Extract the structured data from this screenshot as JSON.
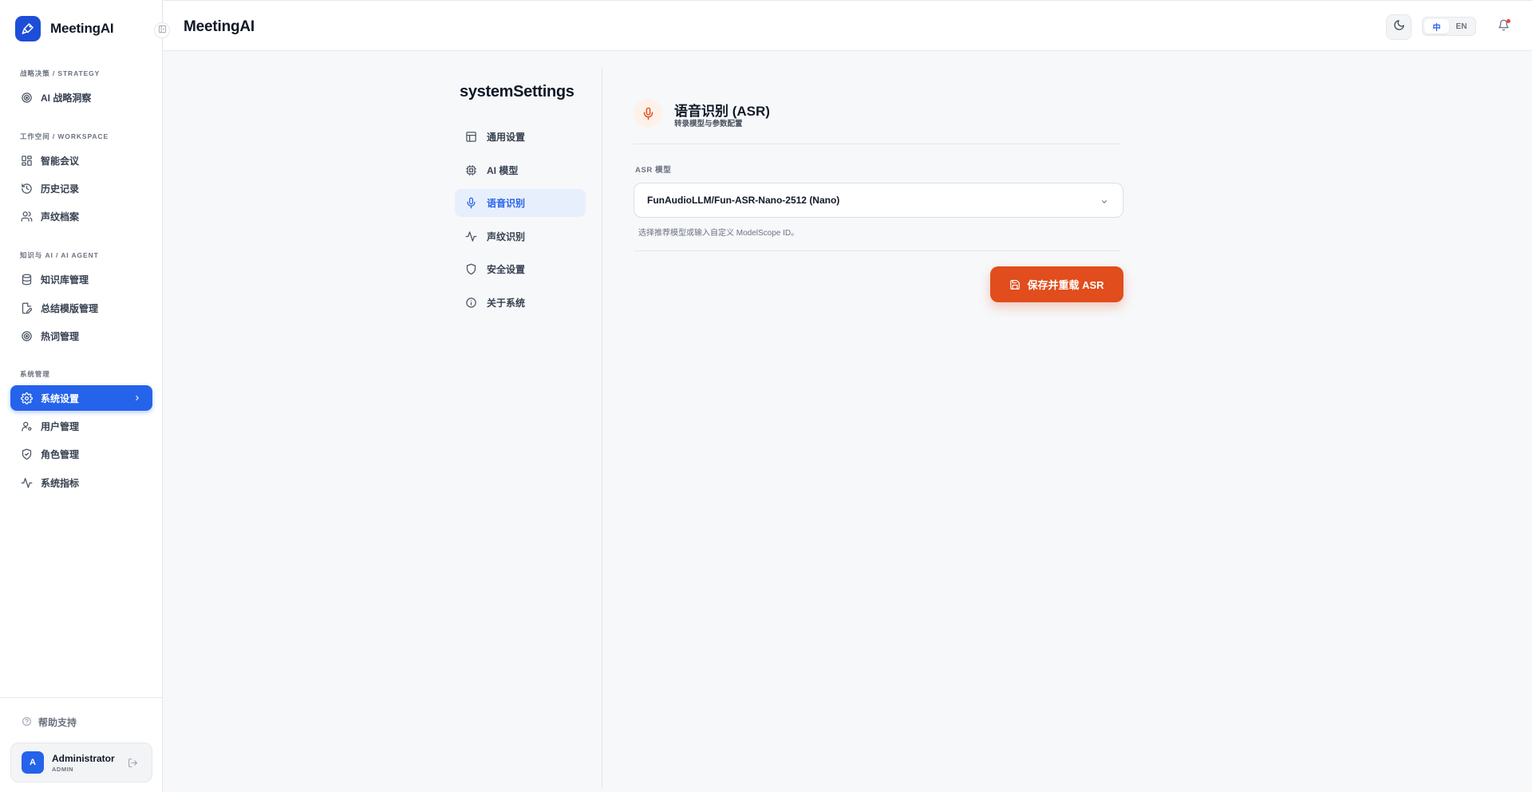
{
  "app": {
    "brand": "MeetingAI",
    "header_title": "MeetingAI"
  },
  "sidebar": {
    "groups": [
      {
        "title": "战略决策 / STRATEGY",
        "items": [
          {
            "label": "AI 战略洞察",
            "icon": "target-icon"
          }
        ]
      },
      {
        "title": "工作空间 / WORKSPACE",
        "items": [
          {
            "label": "智能会议",
            "icon": "grid-icon"
          },
          {
            "label": "历史记录",
            "icon": "history-icon"
          },
          {
            "label": "声纹档案",
            "icon": "users-icon"
          }
        ]
      },
      {
        "title": "知识与 AI / AI AGENT",
        "items": [
          {
            "label": "知识库管理",
            "icon": "database-icon"
          },
          {
            "label": "总结模版管理",
            "icon": "file-edit-icon"
          },
          {
            "label": "热词管理",
            "icon": "target-icon"
          }
        ]
      },
      {
        "title": "系统管理",
        "items": [
          {
            "label": "系统设置",
            "icon": "gear-icon",
            "active": true
          },
          {
            "label": "用户管理",
            "icon": "user-gear-icon"
          },
          {
            "label": "角色管理",
            "icon": "shield-check-icon"
          },
          {
            "label": "系统指标",
            "icon": "activity-icon"
          }
        ]
      }
    ],
    "help": "帮助支持",
    "user": {
      "initial": "A",
      "name": "Administrator",
      "role": "ADMIN"
    }
  },
  "topbar": {
    "lang": {
      "zh": "中",
      "en": "EN",
      "selected": "中"
    },
    "has_notification": true
  },
  "settings": {
    "title": "systemSettings",
    "menu": [
      {
        "label": "通用设置",
        "icon": "layout-icon"
      },
      {
        "label": "AI 模型",
        "icon": "cpu-icon"
      },
      {
        "label": "语音识别",
        "icon": "mic-icon",
        "active": true
      },
      {
        "label": "声纹识别",
        "icon": "activity-icon"
      },
      {
        "label": "安全设置",
        "icon": "shield-icon"
      },
      {
        "label": "关于系统",
        "icon": "info-icon"
      }
    ]
  },
  "content": {
    "title": "语音识别 (ASR)",
    "subtitle": "转录模型与参数配置",
    "field_label": "ASR 模型",
    "model_value": "FunAudioLLM/Fun-ASR-Nano-2512 (Nano)",
    "help_text": "选择推荐模型或输入自定义 ModelScope ID。",
    "save_label": "保存并重载 ASR"
  },
  "colors": {
    "primary": "#2563eb",
    "accent": "#e14d1c",
    "brand": "#1d4ed8"
  }
}
